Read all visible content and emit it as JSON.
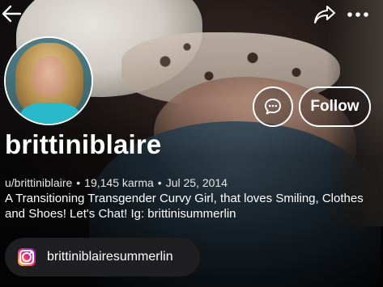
{
  "profile": {
    "display_name": "brittiniblaire",
    "username": "u/brittiniblaire",
    "karma": "19,145 karma",
    "cake_day": "Jul 25, 2014",
    "bio": "A Transitioning Transgender Curvy Girl, that loves Smiling, Clothes and Shoes! Let's Chat! Ig: brittinisummerlin"
  },
  "actions": {
    "follow_label": "Follow",
    "chat_icon": "chat-bubble-icon",
    "back_icon": "back-arrow-icon",
    "share_icon": "share-icon",
    "more_icon": "more-dots-icon"
  },
  "social_links": [
    {
      "platform_icon": "instagram-icon",
      "label": "brittiniblairesummerlin"
    }
  ],
  "colors": {
    "text": "#ffffff",
    "chip_bg": "#1f1f21",
    "avatar_top": "#29b8c9"
  },
  "separator": "•"
}
